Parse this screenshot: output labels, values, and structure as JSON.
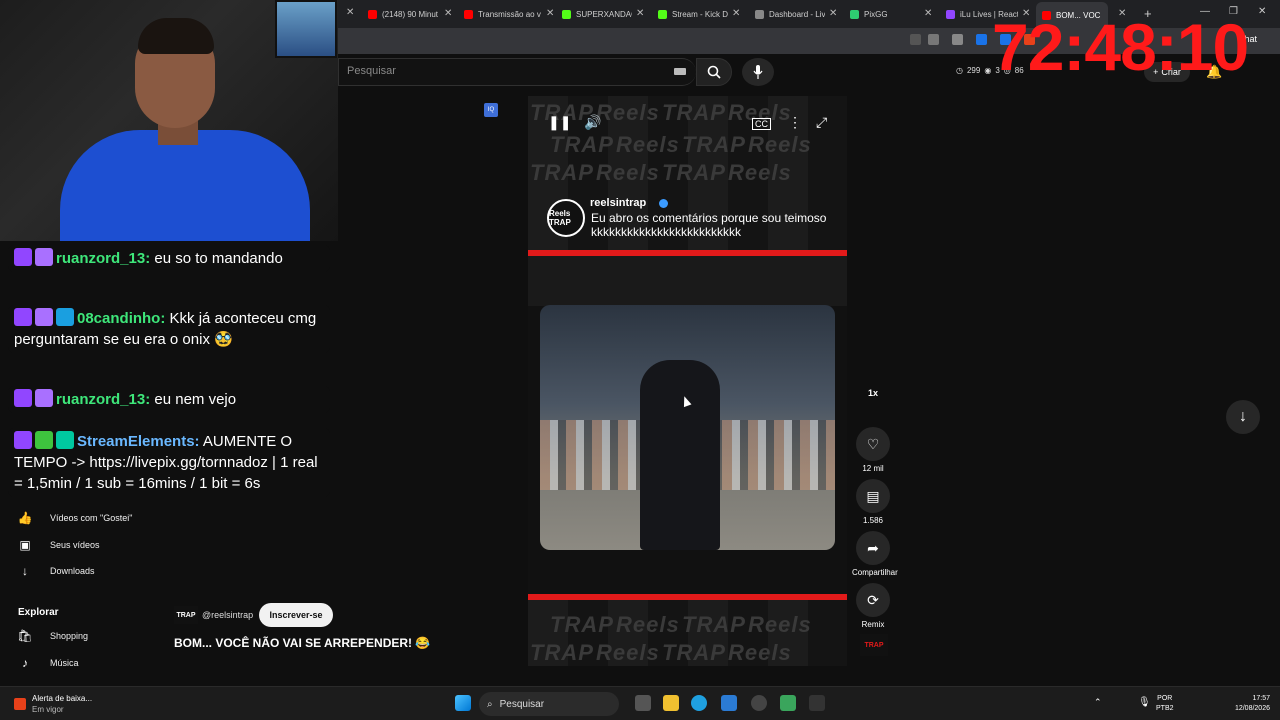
{
  "browser": {
    "tabs": [
      {
        "label": "(2148) 90 Minut",
        "color": "#ff0000"
      },
      {
        "label": "Transmissão ao v",
        "color": "#ff0000"
      },
      {
        "label": "SUPERXANDAO",
        "color": "#53fc18"
      },
      {
        "label": "Stream - Kick Da",
        "color": "#53fc18"
      },
      {
        "label": "Dashboard - Liv",
        "color": "#888888"
      },
      {
        "label": "PixGG",
        "color": "#2ecc71"
      },
      {
        "label": "iLu Lives | React",
        "color": "#9146ff"
      },
      {
        "label": "BOM... VOC",
        "color": "#ff0000"
      }
    ],
    "new_tab": "+",
    "chat_label": "Chat"
  },
  "youtube": {
    "search_placeholder": "Pesquisar",
    "stats": {
      "a": "299",
      "b": "3",
      "c": "86"
    },
    "create_label": "Criar"
  },
  "timer": "72:48:10",
  "chat_messages": [
    {
      "user": "ruanzord_13:",
      "user_color": "#3ee67a",
      "text": " eu so to mandando"
    },
    {
      "user": "08candinho:",
      "user_color": "#3ee67a",
      "text": " Kkk já aconteceu cmg perguntaram se eu era o onix 🥸"
    },
    {
      "user": "ruanzord_13:",
      "user_color": "#3ee67a",
      "text": " eu nem vejo"
    },
    {
      "user": "StreamElements:",
      "user_color": "#6ab8ff",
      "text": " AUMENTE O TEMPO -> https://livepix.gg/tornnadoz | 1 real = 1,5min / 1 sub = 16mins / 1 bit = 6s"
    }
  ],
  "sidebar": {
    "items": [
      {
        "label": "Vídeos com \"Gostei\"",
        "icon": "thumbs-up-icon"
      },
      {
        "label": "Seus vídeos",
        "icon": "play-square-icon"
      },
      {
        "label": "Downloads",
        "icon": "download-icon"
      }
    ],
    "explore_heading": "Explorar",
    "explore_items": [
      {
        "label": "Shopping",
        "icon": "bag-icon"
      },
      {
        "label": "Música",
        "icon": "music-icon"
      }
    ]
  },
  "short": {
    "overlay_channel": "reelsintrap",
    "overlay_caption": "Eu abro os comentários porque sou teimoso kkkkkkkkkkkkkkkkkkkkkkkkk",
    "avatar_text": "Reels TRAP",
    "bg_word": "TRAP",
    "bg_word2": "Reels",
    "speed": "1x",
    "likes": "12 mil",
    "comments": "1.586",
    "share_label": "Compartilhar",
    "remix_label": "Remix",
    "channel_handle": "@reelsintrap",
    "subscribe_label": "Inscrever-se",
    "title": "BOM... VOCÊ NÃO VAI SE ARREPENDER! 😂"
  },
  "taskbar": {
    "alert_title": "Alerta de baixa...",
    "alert_sub": "Em vigor",
    "search_label": "Pesquisar",
    "lang_top": "POR",
    "lang_bottom": "PTB2",
    "time": "17:57",
    "date": "12/08/2026"
  }
}
